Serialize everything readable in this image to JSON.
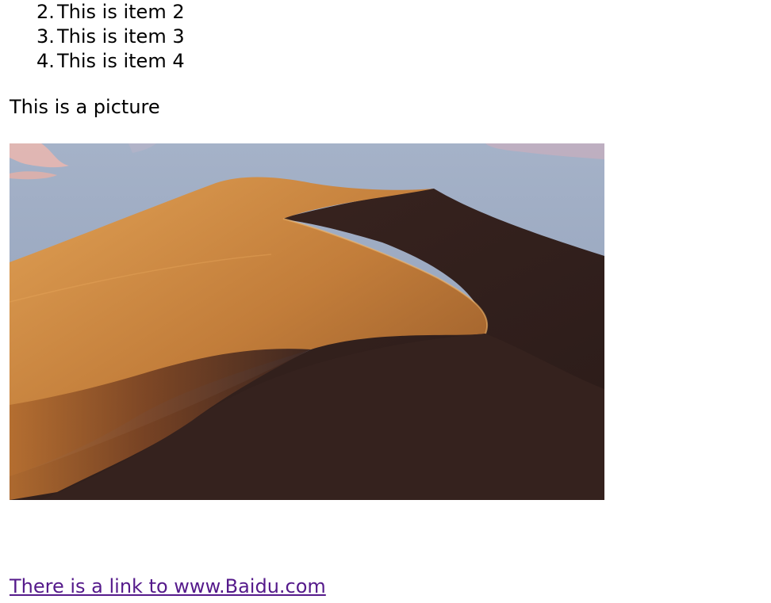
{
  "list": {
    "items": [
      {
        "number": "2.",
        "label": "This is item 2"
      },
      {
        "number": "3.",
        "label": "This is item 3"
      },
      {
        "number": "4.",
        "label": "This is item 4"
      }
    ]
  },
  "intro_text": "This is a picture",
  "image": {
    "subject": "desert sand dune at dusk",
    "colors": {
      "sky_top": "#9aa9c4",
      "sky_bottom": "#8f9fb8",
      "sand_lit": "#d8974b",
      "sand_mid": "#a9652b",
      "sand_shadow": "#3a241f"
    }
  },
  "link": {
    "text": "There is a link to www.Baidu.com",
    "color": "#551a8b"
  }
}
